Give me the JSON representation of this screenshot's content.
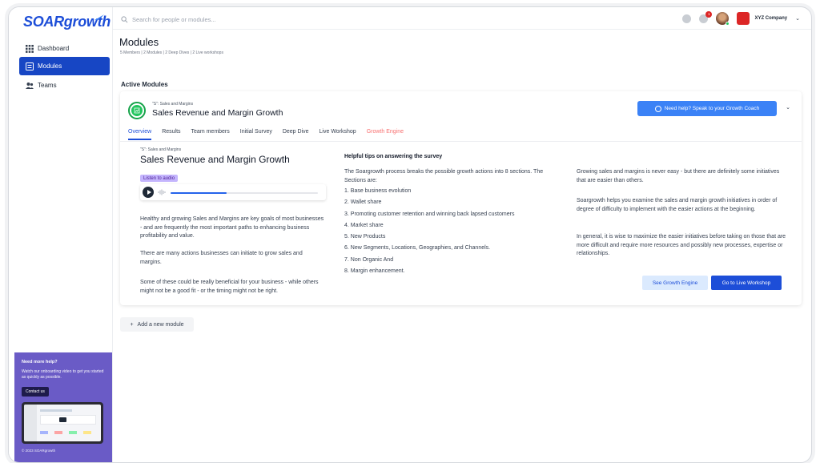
{
  "brand": {
    "logo_text": "SOARgrowth"
  },
  "sidebar": {
    "items": [
      {
        "label": "Dashboard",
        "icon": "grid-icon"
      },
      {
        "label": "Modules",
        "icon": "modules-icon",
        "active": true
      },
      {
        "label": "Teams",
        "icon": "teams-icon"
      }
    ],
    "help": {
      "title": "Need more help?",
      "description": "Watch our onboarding video to get you started as quickly as possible.",
      "button": "Contact us",
      "copyright": "© 2023 SOARgrowth"
    }
  },
  "topbar": {
    "search_placeholder": "Search for people or modules...",
    "notification_count": "1",
    "company": "XYZ Company"
  },
  "page": {
    "title": "Modules",
    "subtitle": "5 Members | 2 Modules | 2 Deep Dives | 2 Live workshops",
    "section_title": "Active Modules",
    "add_module": "Add a new module"
  },
  "module": {
    "category": "\"S\": Sales and Margins",
    "title": "Sales Revenue and Margin Growth",
    "coach_button": "Need help? Speak to your Growth Coach",
    "tabs": [
      "Overview",
      "Results",
      "Team members",
      "Initial Survey",
      "Deep Dive",
      "Live Workshop",
      "Growth Engine"
    ],
    "overview": {
      "category": "\"S\": Sales and Margins",
      "title": "Sales Revenue and Margin Growth",
      "listen_label": "Listen to audio",
      "audio_progress": 0.38,
      "paragraphs": [
        "Healthy and growing Sales and Margins are key goals of most businesses - and are frequently the most important paths to enhancing business profitability and value.",
        "There are many actions businesses can initiate to grow sales and margins.",
        "Some of these could be really beneficial for your business - while others might not be a good fit - or the timing might not be right."
      ]
    },
    "tips": {
      "title": "Helpful tips on answering the survey",
      "intro": "The Soargrowth process breaks the possible growth actions into 8 sections. The Sections are:",
      "list": [
        "1. Base business evolution",
        "2. Wallet share",
        "3. Promoting customer retention and winning back lapsed customers",
        "4. Market share",
        "5. New Products",
        "6. New Segments, Locations, Geographies, and Channels.",
        "7. Non Organic And",
        "8. Margin enhancement."
      ],
      "right_paragraphs": [
        "Growing sales and margins is never easy - but there are definitely some initiatives that are easier than others.",
        "Soargrowth helps you examine the sales and margin growth initiatives in order of degree of difficulty to implement with the easier actions at the beginning.",
        "In general, it is wise to maximize the easier initiatives before taking on those that are more difficult and require more resources and possibly new processes, expertise or relationships."
      ]
    },
    "buttons": {
      "see_growth_engine": "See Growth Engine",
      "live_workshop": "Go to Live Workshop"
    }
  }
}
